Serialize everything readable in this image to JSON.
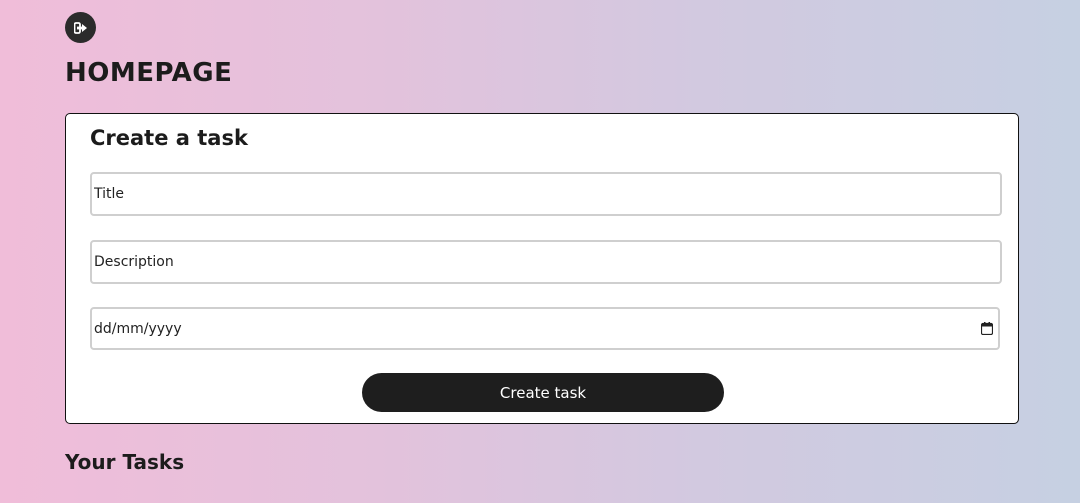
{
  "header": {
    "logout_icon": "logout-icon",
    "title": "HOMEPAGE"
  },
  "create_task": {
    "heading": "Create a task",
    "title_placeholder": "Title",
    "description_placeholder": "Description",
    "date_placeholder": "dd/mm/yyyy",
    "calendar_icon": "calendar-icon",
    "submit_label": "Create task"
  },
  "tasks": {
    "heading": "Your Tasks"
  },
  "colors": {
    "background_start": "#f0bdd9",
    "background_end": "#c6d0e2",
    "button": "#1e1e1e",
    "card": "#ffffff"
  }
}
